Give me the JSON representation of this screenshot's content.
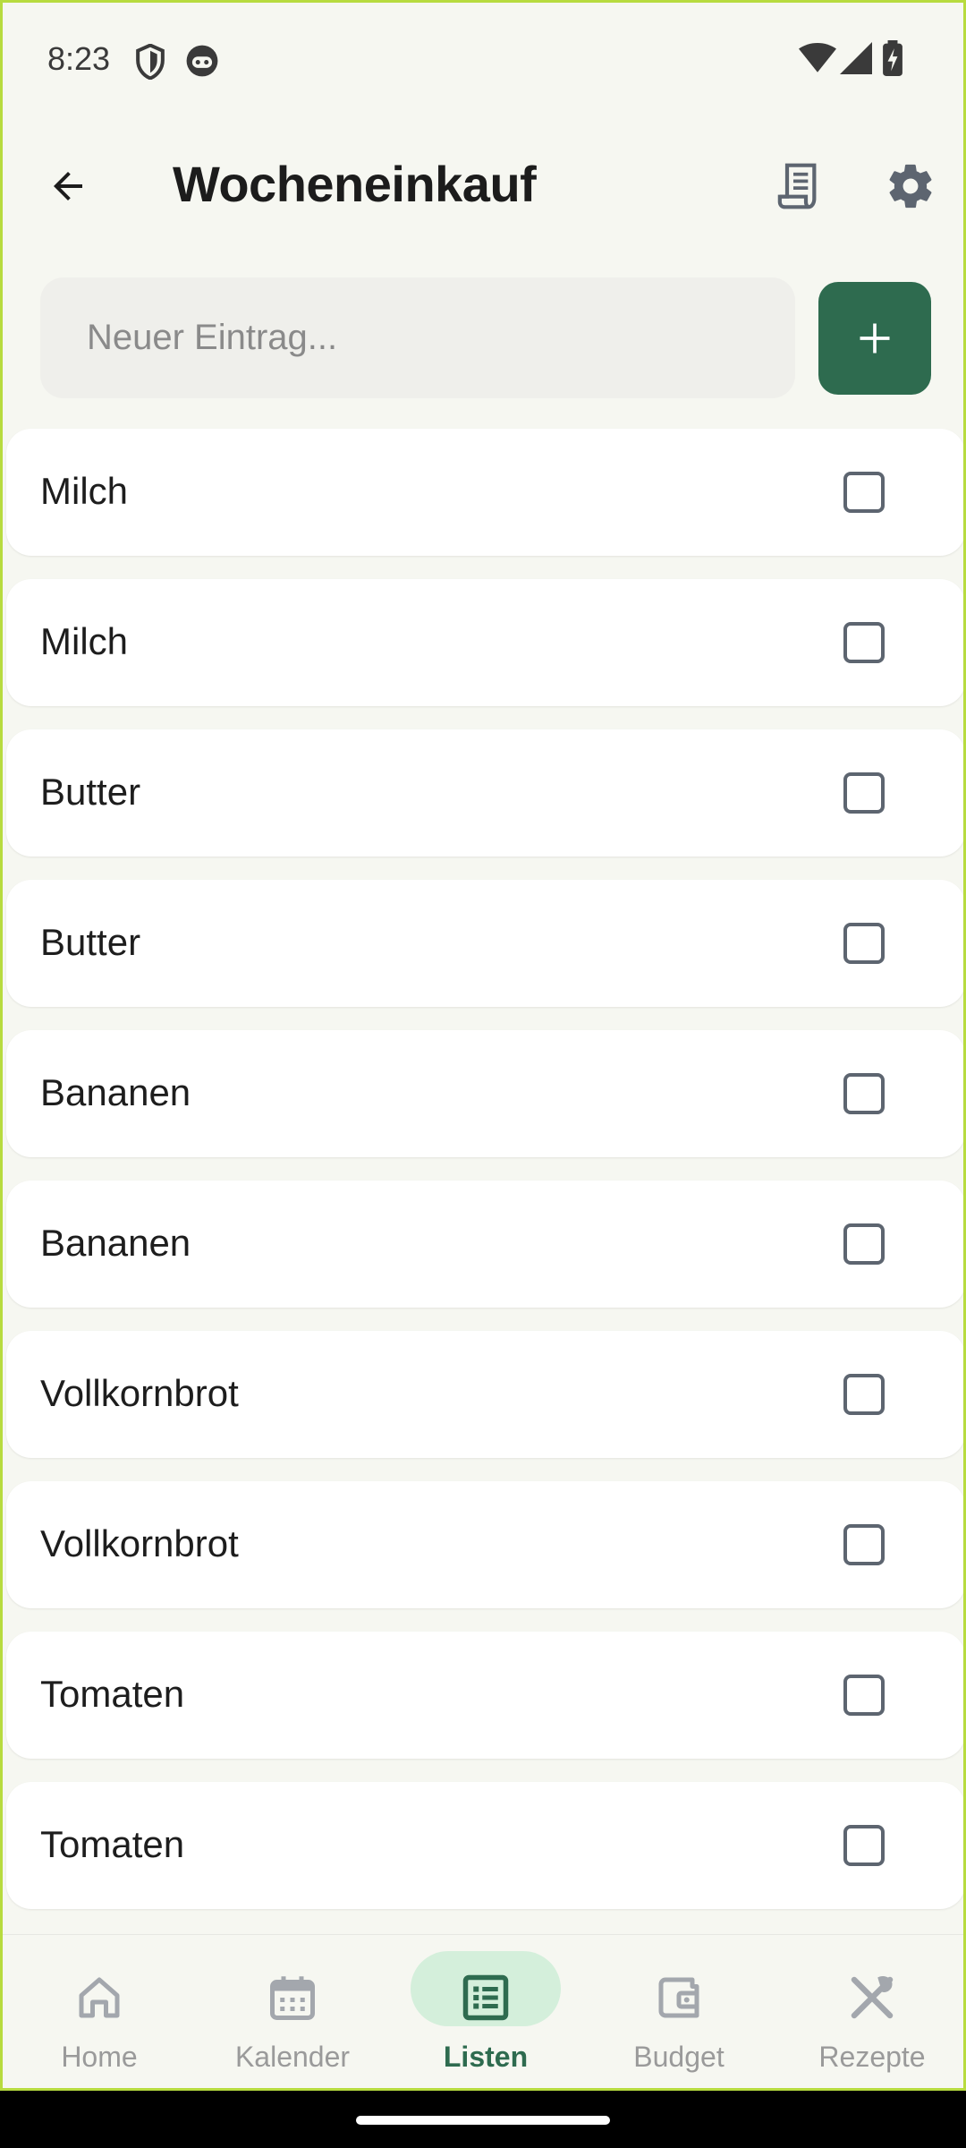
{
  "status_bar": {
    "time": "8:23",
    "icons": [
      "shield-icon",
      "face-icon",
      "wifi-icon",
      "signal-icon",
      "battery-charging-icon"
    ]
  },
  "app_bar": {
    "title": "Wocheneinkauf",
    "back_icon": "arrow-back-icon",
    "receipt_icon": "receipt-icon",
    "settings_icon": "gear-icon"
  },
  "entry": {
    "placeholder": "Neuer Eintrag...",
    "value": "",
    "add_icon": "plus-icon"
  },
  "items": [
    {
      "label": "Milch",
      "checked": false
    },
    {
      "label": "Milch",
      "checked": false
    },
    {
      "label": "Butter",
      "checked": false
    },
    {
      "label": "Butter",
      "checked": false
    },
    {
      "label": "Bananen",
      "checked": false
    },
    {
      "label": "Bananen",
      "checked": false
    },
    {
      "label": "Vollkornbrot",
      "checked": false
    },
    {
      "label": "Vollkornbrot",
      "checked": false
    },
    {
      "label": "Tomaten",
      "checked": false
    },
    {
      "label": "Tomaten",
      "checked": false
    }
  ],
  "nav": [
    {
      "label": "Home",
      "icon": "home-icon",
      "active": false
    },
    {
      "label": "Kalender",
      "icon": "calendar-icon",
      "active": false
    },
    {
      "label": "Listen",
      "icon": "list-icon",
      "active": true
    },
    {
      "label": "Budget",
      "icon": "wallet-icon",
      "active": false
    },
    {
      "label": "Rezepte",
      "icon": "utensils-icon",
      "active": false
    }
  ],
  "colors": {
    "accent": "#2e6b4f",
    "active_pill": "#d4efdb",
    "background": "#f6f7f1",
    "frame": "#b7db3f"
  }
}
